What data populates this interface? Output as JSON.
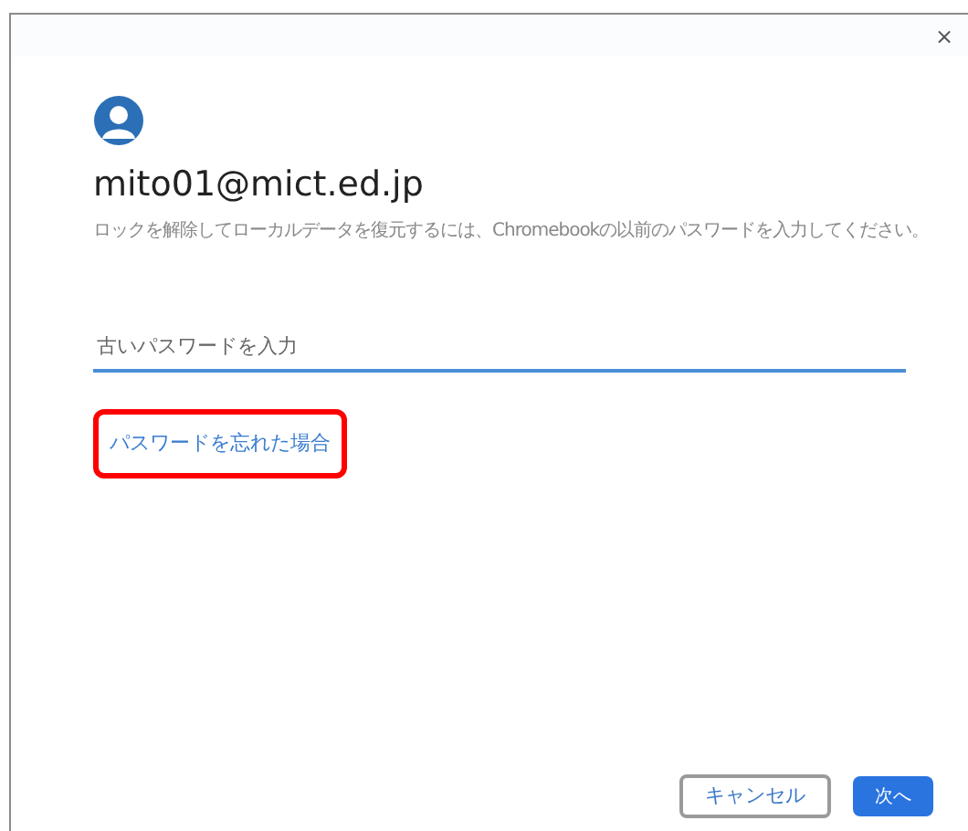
{
  "dialog": {
    "close": "×",
    "account": "mito01@mict.ed.jp",
    "description": "ロックを解除してローカルデータを復元するには、Chromebookの以前のパスワードを入力してください。",
    "password_field": {
      "placeholder": "古いパスワードを入力"
    },
    "forgot_link": {
      "label": "パスワードを忘れた場合",
      "highlighted": true
    },
    "buttons": [
      {
        "label": "キャンセル",
        "kind": "secondary"
      },
      {
        "label": "次へ",
        "kind": "primary"
      }
    ]
  }
}
